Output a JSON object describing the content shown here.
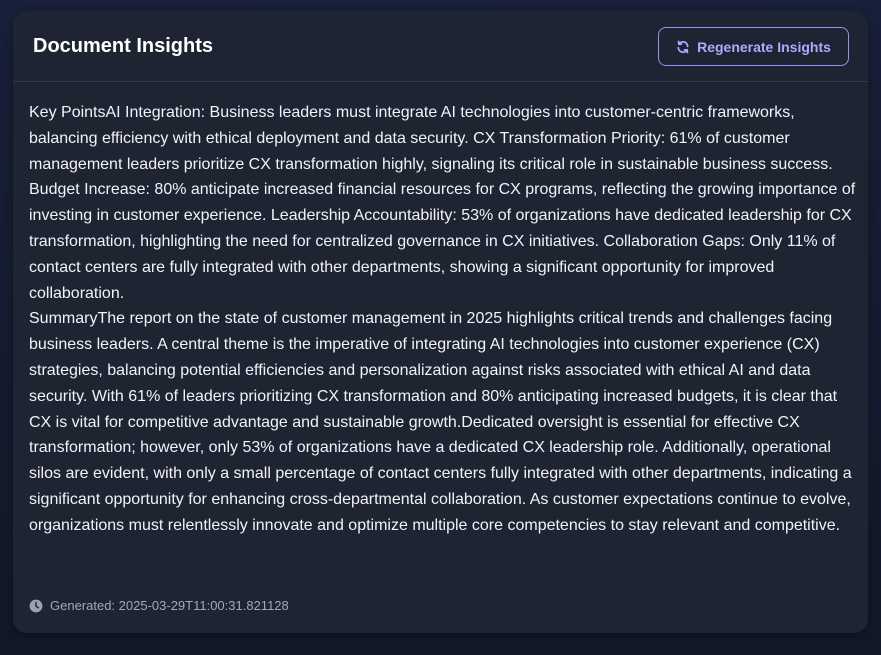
{
  "header": {
    "title": "Document Insights",
    "regenerate_label": "Regenerate Insights",
    "regenerate_icon": "refresh-icon"
  },
  "content": {
    "key_points": "Key PointsAI Integration: Business leaders must integrate AI technologies into customer-centric frameworks, balancing efficiency with ethical deployment and data security. CX Transformation Priority: 61% of customer management leaders prioritize CX transformation highly, signaling its critical role in sustainable business success. Budget Increase: 80% anticipate increased financial resources for CX programs, reflecting the growing importance of investing in customer experience. Leadership Accountability: 53% of organizations have dedicated leadership for CX transformation, highlighting the need for centralized governance in CX initiatives. Collaboration Gaps: Only 11% of contact centers are fully integrated with other departments, showing a significant opportunity for improved collaboration.",
    "summary": "SummaryThe report on the state of customer management in 2025 highlights critical trends and challenges facing business leaders. A central theme is the imperative of integrating AI technologies into customer experience (CX) strategies, balancing potential efficiencies and personalization against risks associated with ethical AI and data security. With 61% of leaders prioritizing CX transformation and 80% anticipating increased budgets, it is clear that CX is vital for competitive advantage and sustainable growth.Dedicated oversight is essential for effective CX transformation; however, only 53% of organizations have a dedicated CX leadership role. Additionally, operational silos are evident, with only a small percentage of contact centers fully integrated with other departments, indicating a significant opportunity for enhancing cross-departmental collaboration. As customer expectations continue to evolve, organizations must relentlessly innovate and optimize multiple core competencies to stay relevant and competitive."
  },
  "footer": {
    "generated_text": "Generated: 2025-03-29T11:00:31.821128",
    "icon": "clock-icon"
  },
  "colors": {
    "accent": "#b3a8ff",
    "card_background": "#1f2433",
    "page_background": "#141a2a"
  }
}
